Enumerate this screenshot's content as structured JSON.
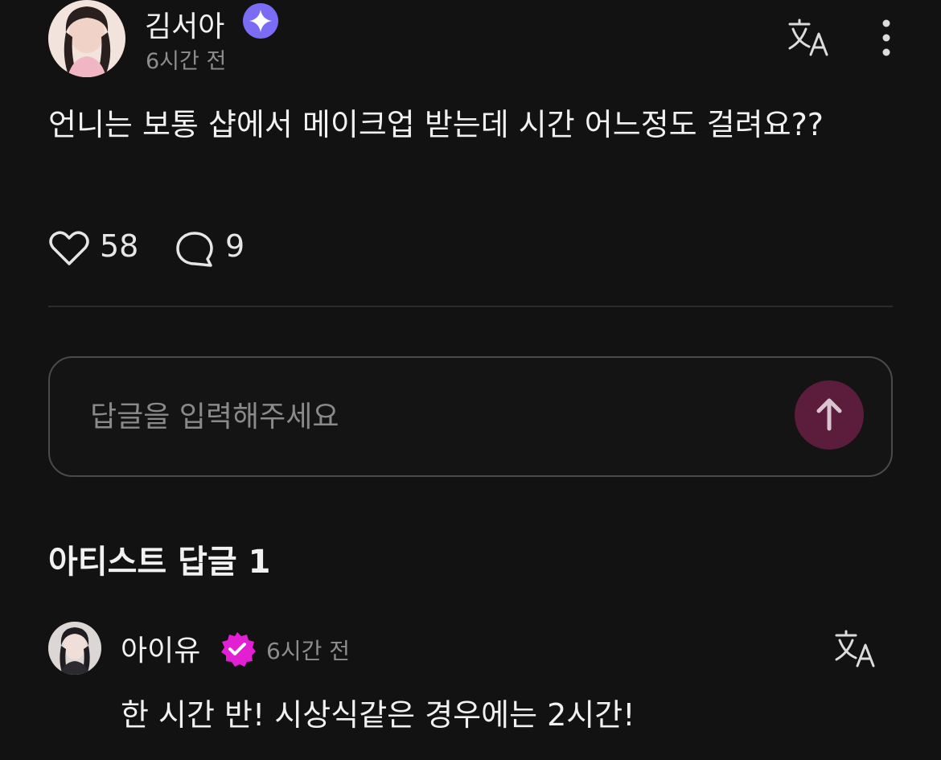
{
  "post": {
    "author": "김서아",
    "time": "6시간 전",
    "body": "언니는 보통 샵에서 메이크업 받는데 시간 어느정도 걸려요??",
    "likes": "58",
    "comments": "9"
  },
  "reply_box": {
    "placeholder": "답글을 입력해주세요"
  },
  "artist_replies": {
    "title": "아티스트 답글 1",
    "items": [
      {
        "author": "아이유",
        "time": "6시간 전",
        "text": "한 시간 반! 시상식같은 경우에는 2시간!"
      }
    ]
  },
  "colors": {
    "background": "#121212",
    "accent_badge_plus": "#7b6cf6",
    "verified_badge": "#e21fd3",
    "send_button": "#5c1d3d"
  },
  "icons": [
    "plus-badge-icon",
    "translate-icon",
    "more-vertical-icon",
    "heart-icon",
    "comment-icon",
    "arrow-up-icon",
    "verified-badge-icon"
  ]
}
